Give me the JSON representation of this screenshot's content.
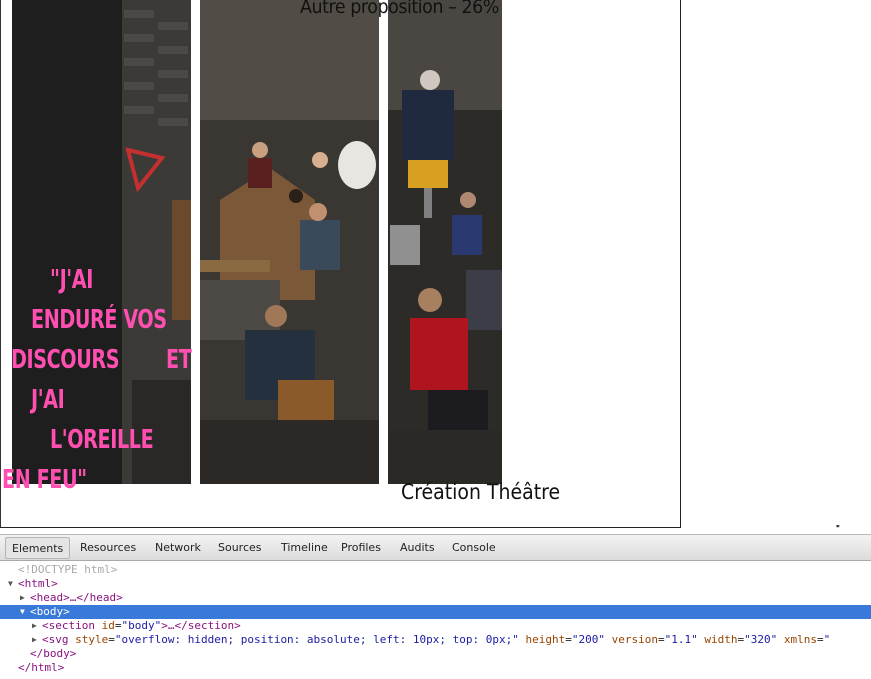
{
  "page": {
    "top_title": "Autre proposition – 26%",
    "caption": "Création Théâtre",
    "quote_lines": [
      "\"J'AI",
      "ENDURÉ  VOS",
      "DISCOURS",
      "ET",
      "J'AI",
      "L'OREILLE",
      "EN FEU\""
    ],
    "ellipsis_marker": "'''",
    "accent_color": "#ff4fb0"
  },
  "devtools": {
    "tabs": [
      "Elements",
      "Resources",
      "Network",
      "Sources",
      "Timeline",
      "Profiles",
      "Audits",
      "Console"
    ],
    "active_tab": "Elements",
    "tree": {
      "doctype": "<!DOCTYPE html>",
      "html_open": "<html>",
      "head": "<head>…</head>",
      "body_open": "<body>",
      "section_open": "<section ",
      "section_attr_name": "id",
      "section_attr_value": "\"body\"",
      "section_close": ">…</section>",
      "svg_open": "<svg ",
      "svg_attr1_name": "style",
      "svg_attr1_value": "\"overflow: hidden; position: absolute; left: 10px; top: 0px;\"",
      "svg_attr2_name": "height",
      "svg_attr2_value": "\"200\"",
      "svg_attr3_name": "version",
      "svg_attr3_value": "\"1.1\"",
      "svg_attr4_name": "width",
      "svg_attr4_value": "\"320\"",
      "svg_attr5_name": "xmlns",
      "svg_attr5_value": "\"",
      "body_close": "</body>",
      "html_close": "</html>"
    }
  }
}
